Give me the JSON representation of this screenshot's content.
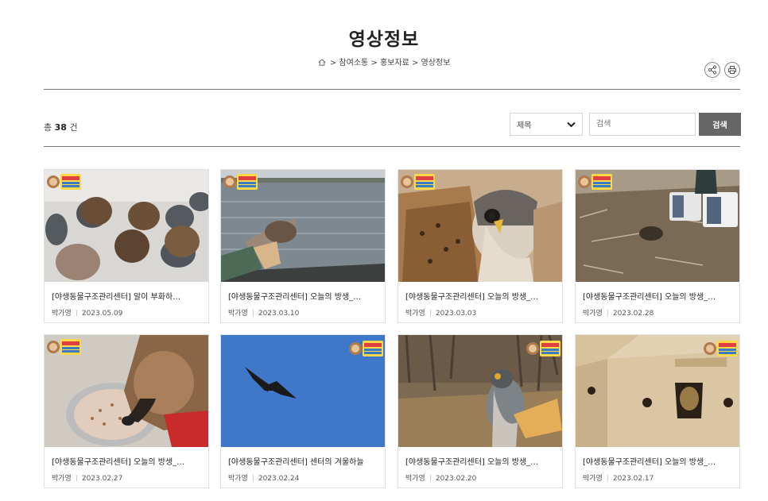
{
  "page": {
    "title": "영상정보",
    "breadcrumb": "> 참여소통 > 홍보자료 > 영상정보"
  },
  "toolbar": {
    "share_icon": "share-icon",
    "print_icon": "print-icon"
  },
  "list": {
    "total_prefix": "총",
    "total_count": "38",
    "total_suffix": "건"
  },
  "search": {
    "select_value": "제목",
    "placeholder": "검색",
    "button_label": "검색"
  },
  "badge": {
    "text": "경기도",
    "sub": "야생동물구조관리센터"
  },
  "videos": [
    {
      "title": "[야생동물구조관리센터] 알이 부화하…",
      "author": "박가영",
      "date": "2023.05.09"
    },
    {
      "title": "[야생동물구조관리센터] 오늘의 방생_…",
      "author": "박가영",
      "date": "2023.03.10"
    },
    {
      "title": "[야생동물구조관리센터] 오늘의 방생_…",
      "author": "박가영",
      "date": "2023.03.03"
    },
    {
      "title": "[야생동물구조관리센터] 오늘의 방생_…",
      "author": "박가영",
      "date": "2023.02.28"
    },
    {
      "title": "[야생동물구조관리센터] 오늘의 방생_…",
      "author": "박가영",
      "date": "2023.02.27"
    },
    {
      "title": "[야생동물구조관리센터] 센터의 겨울하늘",
      "author": "박가영",
      "date": "2023.02.24"
    },
    {
      "title": "[야생동물구조관리센터] 오늘의 방생_…",
      "author": "박가영",
      "date": "2023.02.20"
    },
    {
      "title": "[야생동물구조관리센터] 오늘의 방생_…",
      "author": "박가영",
      "date": "2023.02.17"
    }
  ]
}
